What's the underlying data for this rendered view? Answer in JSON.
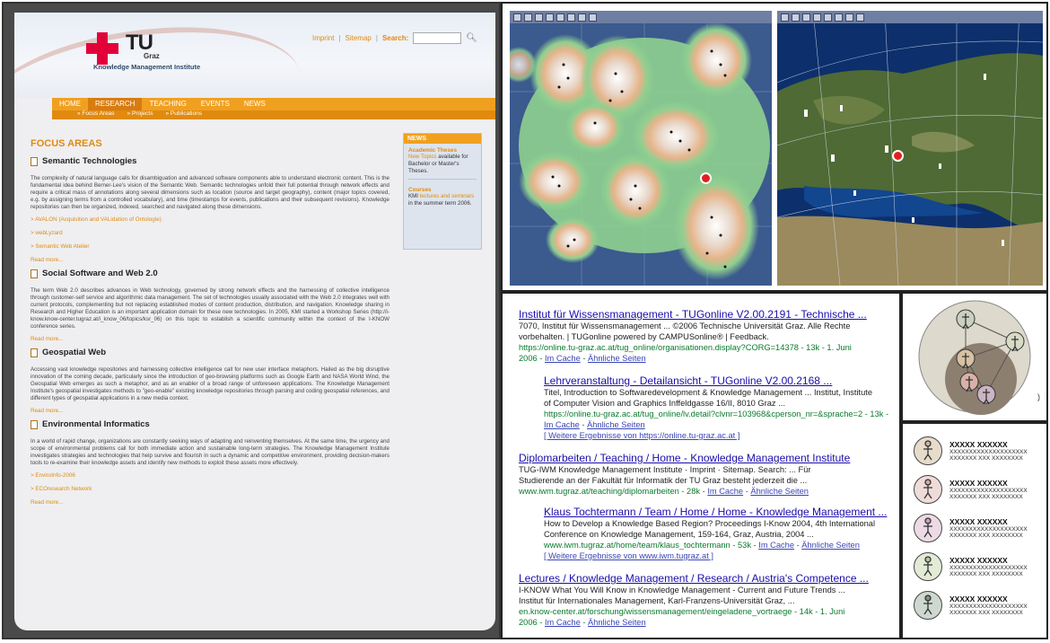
{
  "website": {
    "logo": {
      "tu": "TU",
      "graz": "Graz",
      "institute": "Knowledge Management Institute"
    },
    "toplinks": {
      "imprint": "Imprint",
      "sitemap": "Sitemap",
      "search_label": "Search:"
    },
    "nav": [
      "HOME",
      "RESEARCH",
      "TEACHING",
      "EVENTS",
      "NEWS"
    ],
    "subnav": [
      "» Focus Areas",
      "» Projects",
      "» Publications"
    ],
    "heading": "FOCUS AREAS",
    "sections": [
      {
        "title": "Semantic Technologies",
        "text": "The complexity of natural language calls for disambiguation and advanced software components able to understand electronic content. This is the fundamental idea behind Berner-Lee's vision of the Semantic Web. Semantic technologies unfold their full potential through network effects and require a critical mass of annotations along several dimensions such as location (source and target geography), content (major topics covered, e.g. by assigning terms from a controlled vocabulary), and time (timestamps for events, publications and their subsequent revisions). Knowledge repositories can then be organized, indexed, searched and navigated along these dimensions.",
        "links": [
          "> AVALON (Acquisition and VALidation of Ontologie)",
          "> webLyzard",
          "> Semantic Web Atelier"
        ],
        "readmore": "Read more..."
      },
      {
        "title": "Social Software and Web 2.0",
        "text": "The term Web 2.0 describes advances in Web technology, governed by strong network effects and the harnessing of collective intelligence through customer-self service and algorithmic data management. The set of technologies usually associated with the Web 2.0 integrates well with current protocols, complementing but not replacing established modes of content production, distribution, and navigation. Knowledge sharing in Research and Higher Education is an important application domain for these new technologies. In 2005, KMI started a Workshop Series (http://i-know.know-center.tugraz.at/i_know_06/topics/ksr_06) on this topic to establish a scientific community within the context of the I-KNOW conference series.",
        "links": [],
        "readmore": "Read more..."
      },
      {
        "title": "Geospatial Web",
        "text": "Accessing vast knowledge repositories and harnessing collective intelligence call for new user interface metaphors. Hailed as the big disruptive innovation of the coming decade, particularly since the introduction of geo-browsing platforms such as Google Earth and NASA World Wind, the Geospatial Web emerges as such a metaphor, and as an enabler of a broad range of unforeseen applications. The Knowledge Management Institute's geospatial investigates methods to \"geo-enable\" existing knowledge repositories through parsing and coding geospatial references, and different types of geospatial applications in a new media context.",
        "links": [],
        "readmore": "Read more..."
      },
      {
        "title": "Environmental Informatics",
        "text": "In a world of rapid change, organizations are constantly seeking ways of adapting and reinventing themselves. At the same time, the urgency and scope of environmental problems call for both immediate action and sustainable long-term strategies. The Knowledge Management Institute investigates strategies and technologies that help survive and flourish in such a dynamic and competitive environment, providing decision-makers tools to re-examine their knowledge assets and identify new methods to exploit these assets more effectively.",
        "links": [
          "> EnviroInfo-2006",
          "> ECOresearch Network"
        ],
        "readmore": "Read more..."
      }
    ],
    "news": {
      "header": "NEWS",
      "item1_title": "Academic Theses",
      "item1_link": "New Topics",
      "item1_text": " available for Bachelor or Master's Theses.",
      "item2_title": "Courses",
      "item2_prefix": "KMI ",
      "item2_link": "lectures and seminars",
      "item2_text": " in the summer term 2006."
    }
  },
  "search_results": [
    {
      "title": "Institut für Wissensmanagement - TUGonline V2.00.2191 - Technische ...",
      "snippet1": "7070, Institut für Wissensmanagement ... ©2006 Technische Universität Graz. Alle Rechte",
      "snippet2": "vorbehalten. | TUGonline powered by CAMPUSonline® | Feedback.",
      "url": "https://online.tu-graz.ac.at/tug_online/organisationen.display?CORG=14378 - 13k - 1. Juni",
      "url2": "2006 - ",
      "cache": "Im Cache",
      "similar": "Ähnliche Seiten"
    },
    {
      "title": "Lehrveranstaltung - Detailansicht - TUGonline V2.00.2168 ...",
      "snippet1": "Titel, Introduction to Softwaredevelopment & Knowledge Management ... Institut, Institute",
      "snippet2": "of Computer Vision and Graphics Inffeldgasse 16/II, 8010 Graz ...",
      "url": "https://online.tu-graz.ac.at/tug_online/lv.detail?clvnr=103968&cperson_nr=&sprache=2 - 13k -",
      "url2": "",
      "cache": "Im Cache",
      "similar": "Ähnliche Seiten",
      "more": "[ Weitere Ergebnisse von https://online.tu-graz.ac.at ]"
    },
    {
      "title": "Diplomarbeiten / Teaching / Home - Knowledge Management Institute",
      "snippet1": "TUG-IWM Knowledge Management Institute · Imprint · Sitemap. Search: ... Für",
      "snippet2": "Studierende an der Fakultät für Informatik der TU Graz besteht jederzeit die ...",
      "url": "www.iwm.tugraz.at/teaching/diplomarbeiten - 28k - ",
      "url2": "",
      "cache": "Im Cache",
      "similar": "Ähnliche Seiten"
    },
    {
      "title": "Klaus Tochtermann / Team / Home / Home - Knowledge Management ...",
      "snippet1": "How to Develop a Knowledge Based Region? Proceedings I-Know 2004, 4th International",
      "snippet2": "Conference on Knowledge Management, 159-164, Graz, Austria, 2004 ...",
      "url": "www.iwm.tugraz.at/home/team/klaus_tochtermann - 53k - ",
      "url2": "",
      "cache": "Im Cache",
      "similar": "Ähnliche Seiten",
      "more": "[ Weitere Ergebnisse von www.iwm.tugraz.at ]"
    },
    {
      "title": "Lectures / Knowledge Management / Research / Austria's Competence ...",
      "snippet1": "I-KNOW What You Will Know in Knowledge Management - Current and Future Trends ...",
      "snippet2": "Institut für Internationales Management, Karl-Franzens-Universität Graz, ...",
      "url": "en.know-center.at/forschung/wissensmanagement/eingeladene_vortraege - 14k - 1. Juni",
      "url2": "2006 - ",
      "cache": "Im Cache",
      "similar": "Ähnliche Seiten"
    }
  ],
  "people": [
    {
      "name": "XXXXX XXXXXX",
      "line1": "XXXXXXXXXXXXXXXXXXXX",
      "line2": "XXXXXXX XXX XXXXXXXX",
      "color": "#c9b79a"
    },
    {
      "name": "XXXXX XXXXXX",
      "line1": "XXXXXXXXXXXXXXXXXXXX",
      "line2": "XXXXXXX XXX XXXXXXXX",
      "color": "#d4a9a0"
    },
    {
      "name": "XXXXX XXXXXX",
      "line1": "XXXXXXXXXXXXXXXXXXXX",
      "line2": "XXXXXXX XXX XXXXXXXX",
      "color": "#c8a0b8"
    },
    {
      "name": "XXXXX XXXXXX",
      "line1": "XXXXXXXXXXXXXXXXXXXX",
      "line2": "XXXXXXX XXX XXXXXXXX",
      "color": "#b5c79a"
    },
    {
      "name": "XXXXX XXXXXX",
      "line1": "XXXXXXXXXXXXXXXXXXXX",
      "line2": "XXXXXXX XXX XXXXXXXX",
      "color": "#7f8f80"
    }
  ],
  "colors": {
    "accent": "#f0a020",
    "link": "#1a0dab",
    "url": "#0a7a2c"
  }
}
